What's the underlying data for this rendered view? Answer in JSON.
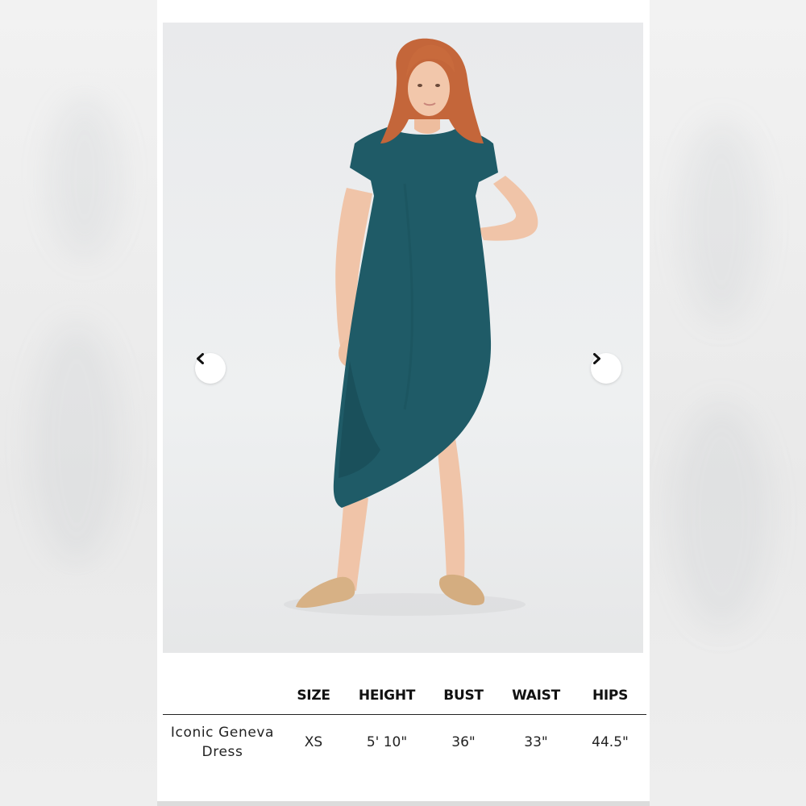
{
  "carousel": {
    "prev_icon": "chevron-left-icon",
    "next_icon": "chevron-right-icon",
    "image_description_colors": {
      "background": "#eceeef",
      "dress": "#1e5a66",
      "hair": "#c8693a",
      "shoes": "#d9b48a"
    }
  },
  "size_table": {
    "headers": [
      "",
      "SIZE",
      "HEIGHT",
      "BUST",
      "WAIST",
      "HIPS"
    ],
    "row": {
      "name_line1": "Iconic Geneva",
      "name_line2": "Dress",
      "size": "XS",
      "height": "5' 10\"",
      "bust": "36\"",
      "waist": "33\"",
      "hips": "44.5\""
    }
  }
}
